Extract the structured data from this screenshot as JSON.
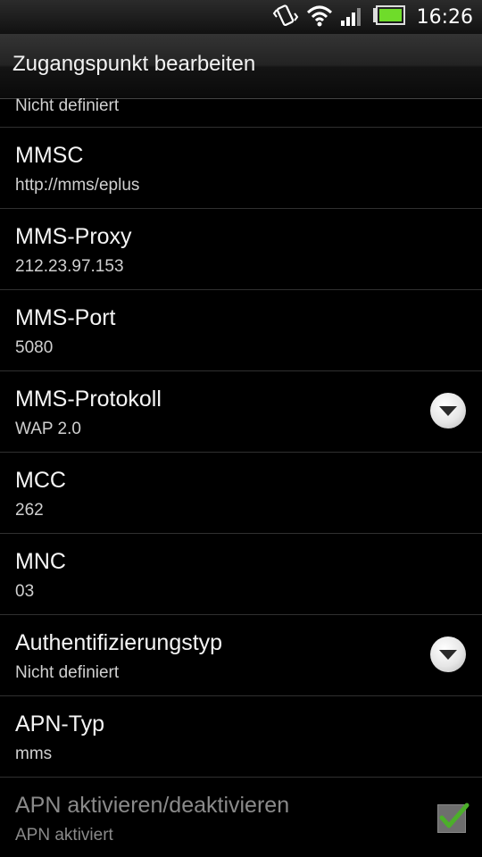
{
  "status_bar": {
    "time": "16:26",
    "icons": [
      "vibrate-icon",
      "wifi-icon",
      "signal-icon",
      "battery-icon"
    ]
  },
  "title": "Zugangspunkt bearbeiten",
  "partial_row": {
    "summary": "Nicht definiert"
  },
  "rows": [
    {
      "label": "MMSC",
      "summary": "http://mms/eplus"
    },
    {
      "label": "MMS-Proxy",
      "summary": "212.23.97.153"
    },
    {
      "label": "MMS-Port",
      "summary": "5080"
    },
    {
      "label": "MMS-Protokoll",
      "summary": "WAP 2.0"
    },
    {
      "label": "MCC",
      "summary": "262"
    },
    {
      "label": "MNC",
      "summary": "03"
    },
    {
      "label": "Authentifizierungstyp",
      "summary": "Nicht definiert"
    },
    {
      "label": "APN-Typ",
      "summary": "mms"
    },
    {
      "label": "APN aktivieren/deaktivieren",
      "summary": "APN aktiviert"
    }
  ],
  "apn_enabled": true,
  "colors": {
    "background": "#000000",
    "divider": "#303030",
    "checkmark": "#4caf2a"
  }
}
